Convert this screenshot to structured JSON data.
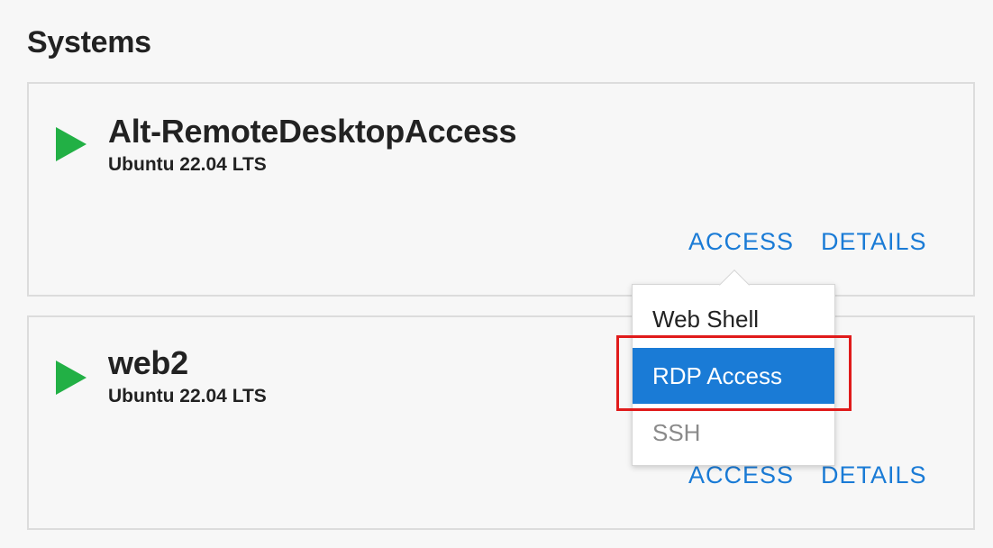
{
  "section": {
    "title": "Systems"
  },
  "systems": [
    {
      "name": "Alt-RemoteDesktopAccess",
      "os": "Ubuntu 22.04 LTS",
      "status_icon": "play-icon",
      "access_label": "ACCESS",
      "details_label": "DETAILS"
    },
    {
      "name": "web2",
      "os": "Ubuntu 22.04 LTS",
      "status_icon": "play-icon",
      "access_label": "ACCESS",
      "details_label": "DETAILS"
    }
  ],
  "access_menu": {
    "items": [
      {
        "label": "Web Shell",
        "state": "default"
      },
      {
        "label": "RDP Access",
        "state": "selected"
      },
      {
        "label": "SSH",
        "state": "disabled"
      }
    ]
  },
  "colors": {
    "accent": "#1a7bd6",
    "status_running": "#22b045",
    "highlight": "#e01b1b"
  }
}
